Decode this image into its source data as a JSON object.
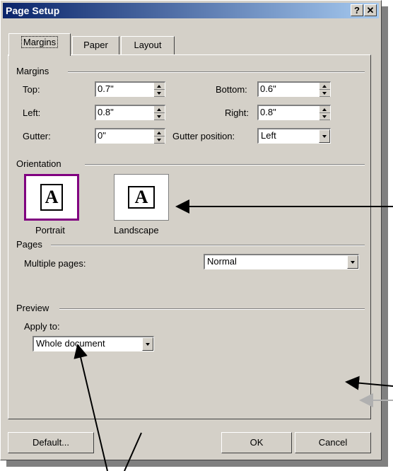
{
  "window": {
    "title": "Page Setup",
    "help_glyph": "?",
    "close_glyph": "✕"
  },
  "tabs": [
    {
      "label": "Margins",
      "active": true
    },
    {
      "label": "Paper",
      "active": false
    },
    {
      "label": "Layout",
      "active": false
    }
  ],
  "margins": {
    "heading": "Margins",
    "top": {
      "label": "Top:",
      "value": "0.7\""
    },
    "bottom": {
      "label": "Bottom:",
      "value": "0.6\""
    },
    "left": {
      "label": "Left:",
      "value": "0.8\""
    },
    "right": {
      "label": "Right:",
      "value": "0.8\""
    },
    "gutter": {
      "label": "Gutter:",
      "value": "0\""
    },
    "gutter_position": {
      "label": "Gutter position:",
      "value": "Left"
    }
  },
  "orientation": {
    "heading": "Orientation",
    "portrait": {
      "label": "Portrait",
      "glyph": "A",
      "selected": true
    },
    "landscape": {
      "label": "Landscape",
      "glyph": "A",
      "selected": false
    }
  },
  "pages": {
    "heading": "Pages",
    "multiple_pages": {
      "label": "Multiple pages:",
      "value": "Normal"
    }
  },
  "preview": {
    "heading": "Preview",
    "apply_to": {
      "label": "Apply to:",
      "value": "Whole document"
    }
  },
  "buttons": {
    "default": "Default...",
    "ok": "OK",
    "cancel": "Cancel"
  },
  "colors": {
    "title_bar": "#0a246a",
    "selection_border": "#800080",
    "dialog_face": "#d4d0c8"
  },
  "icons": [
    "help-icon",
    "close-icon",
    "spin-up-icon",
    "spin-down-icon",
    "dropdown-arrow-icon",
    "portrait-page-icon",
    "landscape-page-icon"
  ]
}
